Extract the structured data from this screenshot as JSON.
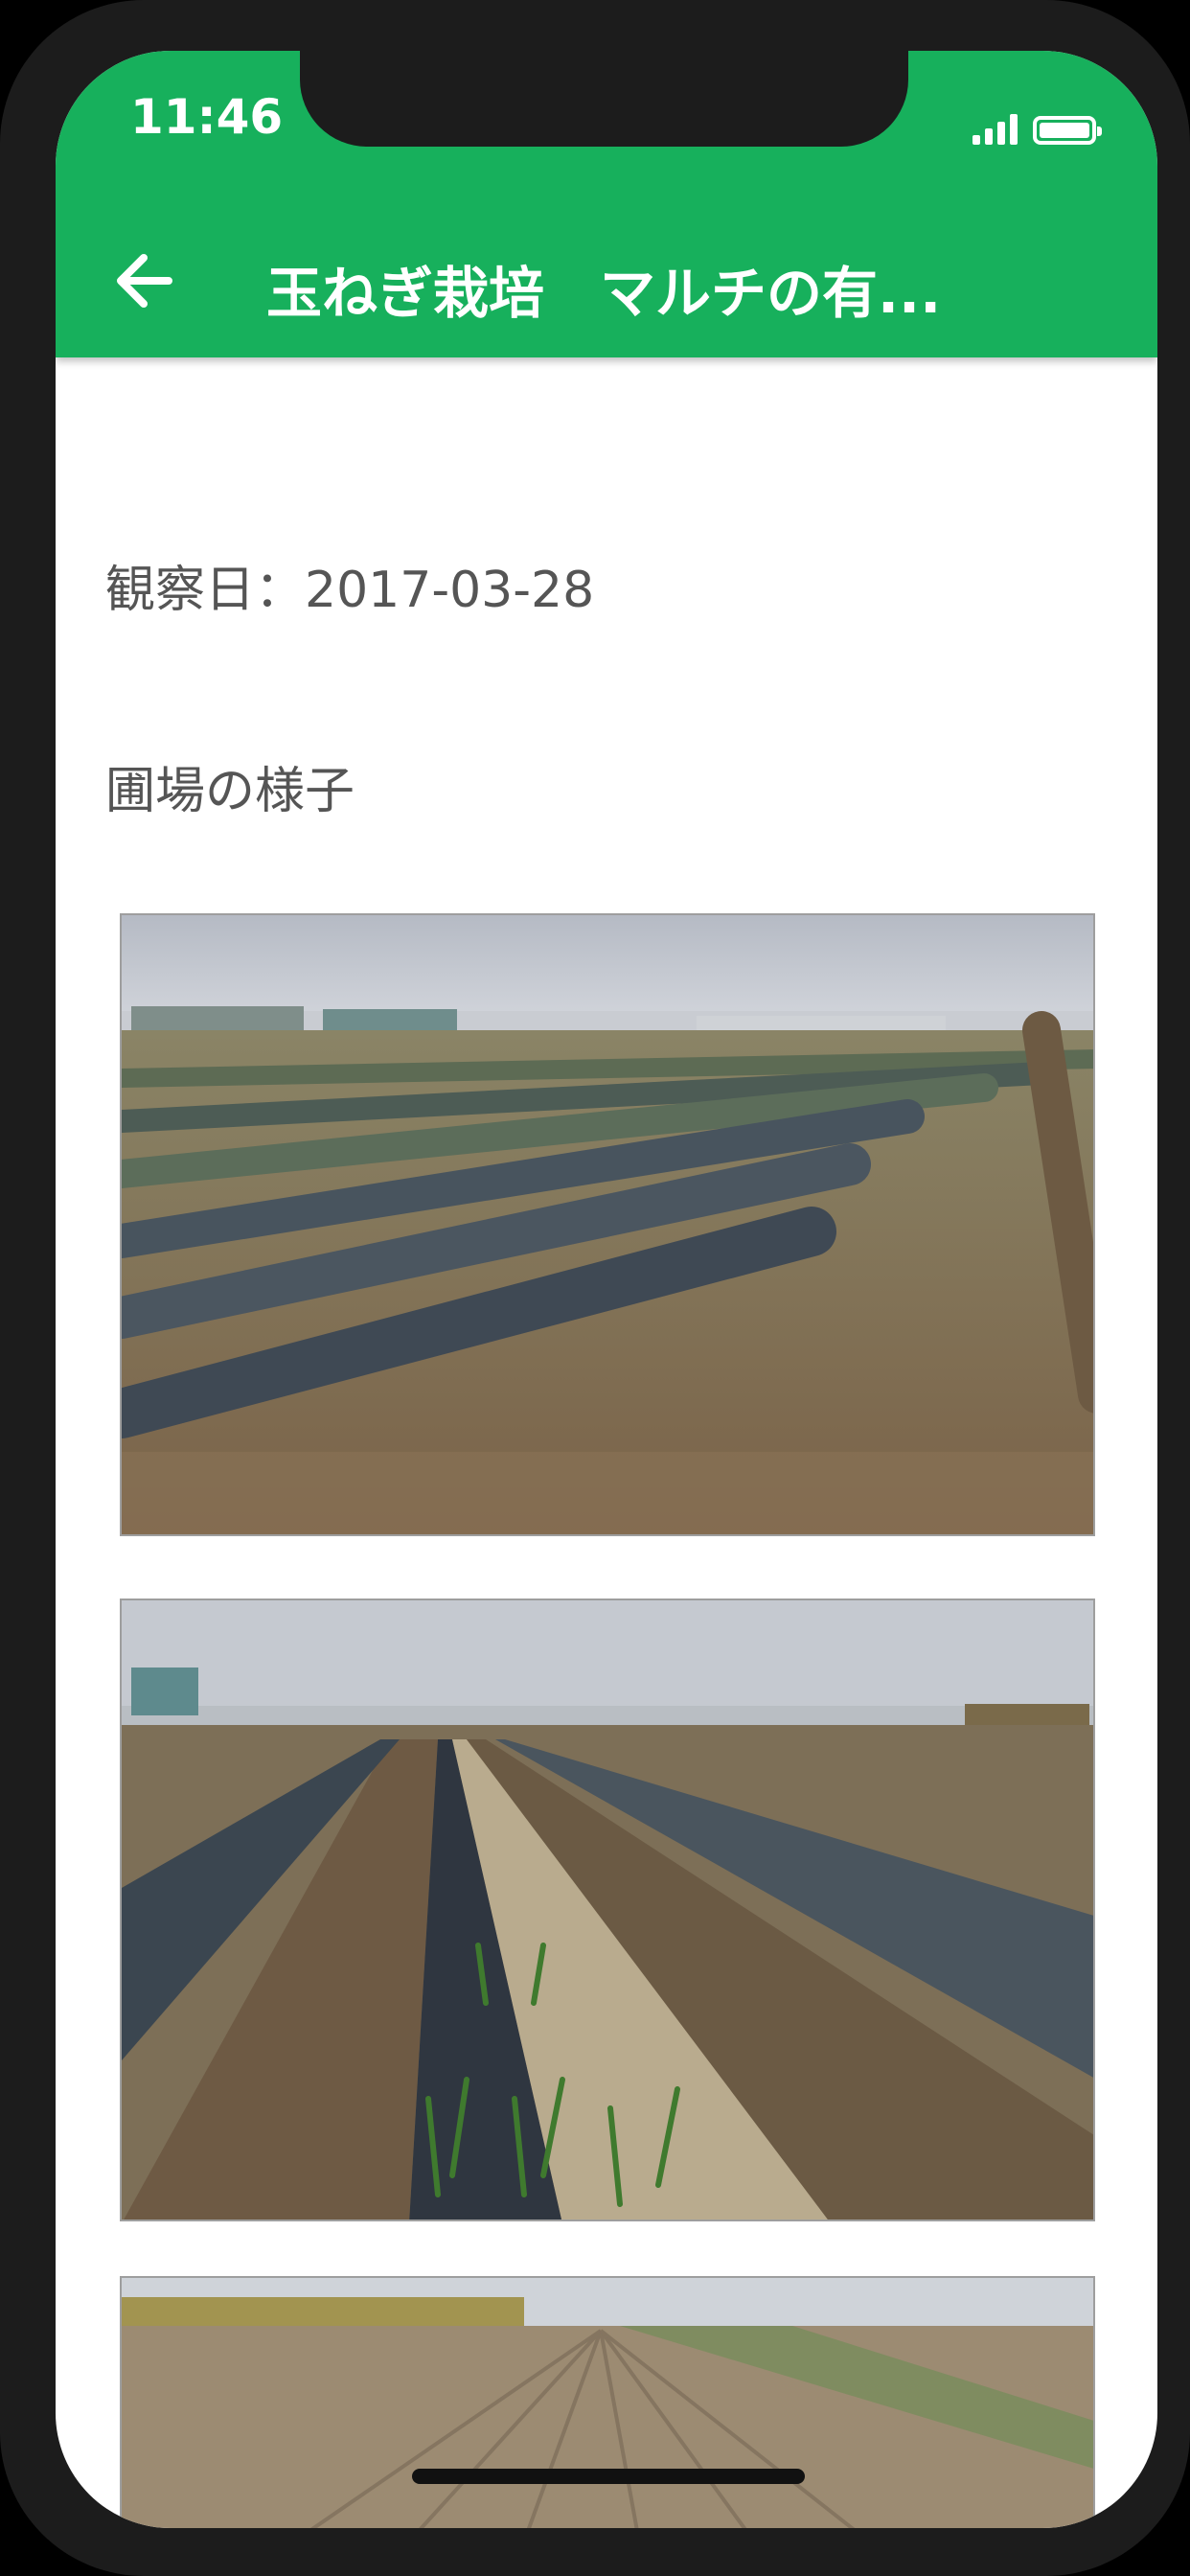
{
  "status_bar": {
    "time": "11:46"
  },
  "header": {
    "back_icon": "arrow-left-icon",
    "title": "玉ねぎ栽培　マルチの有..."
  },
  "content": {
    "observation_date": "観察日：2017-03-28",
    "section_label": "圃場の様子"
  },
  "colors": {
    "header_bg": "#17b05c",
    "text_secondary": "#555555"
  }
}
